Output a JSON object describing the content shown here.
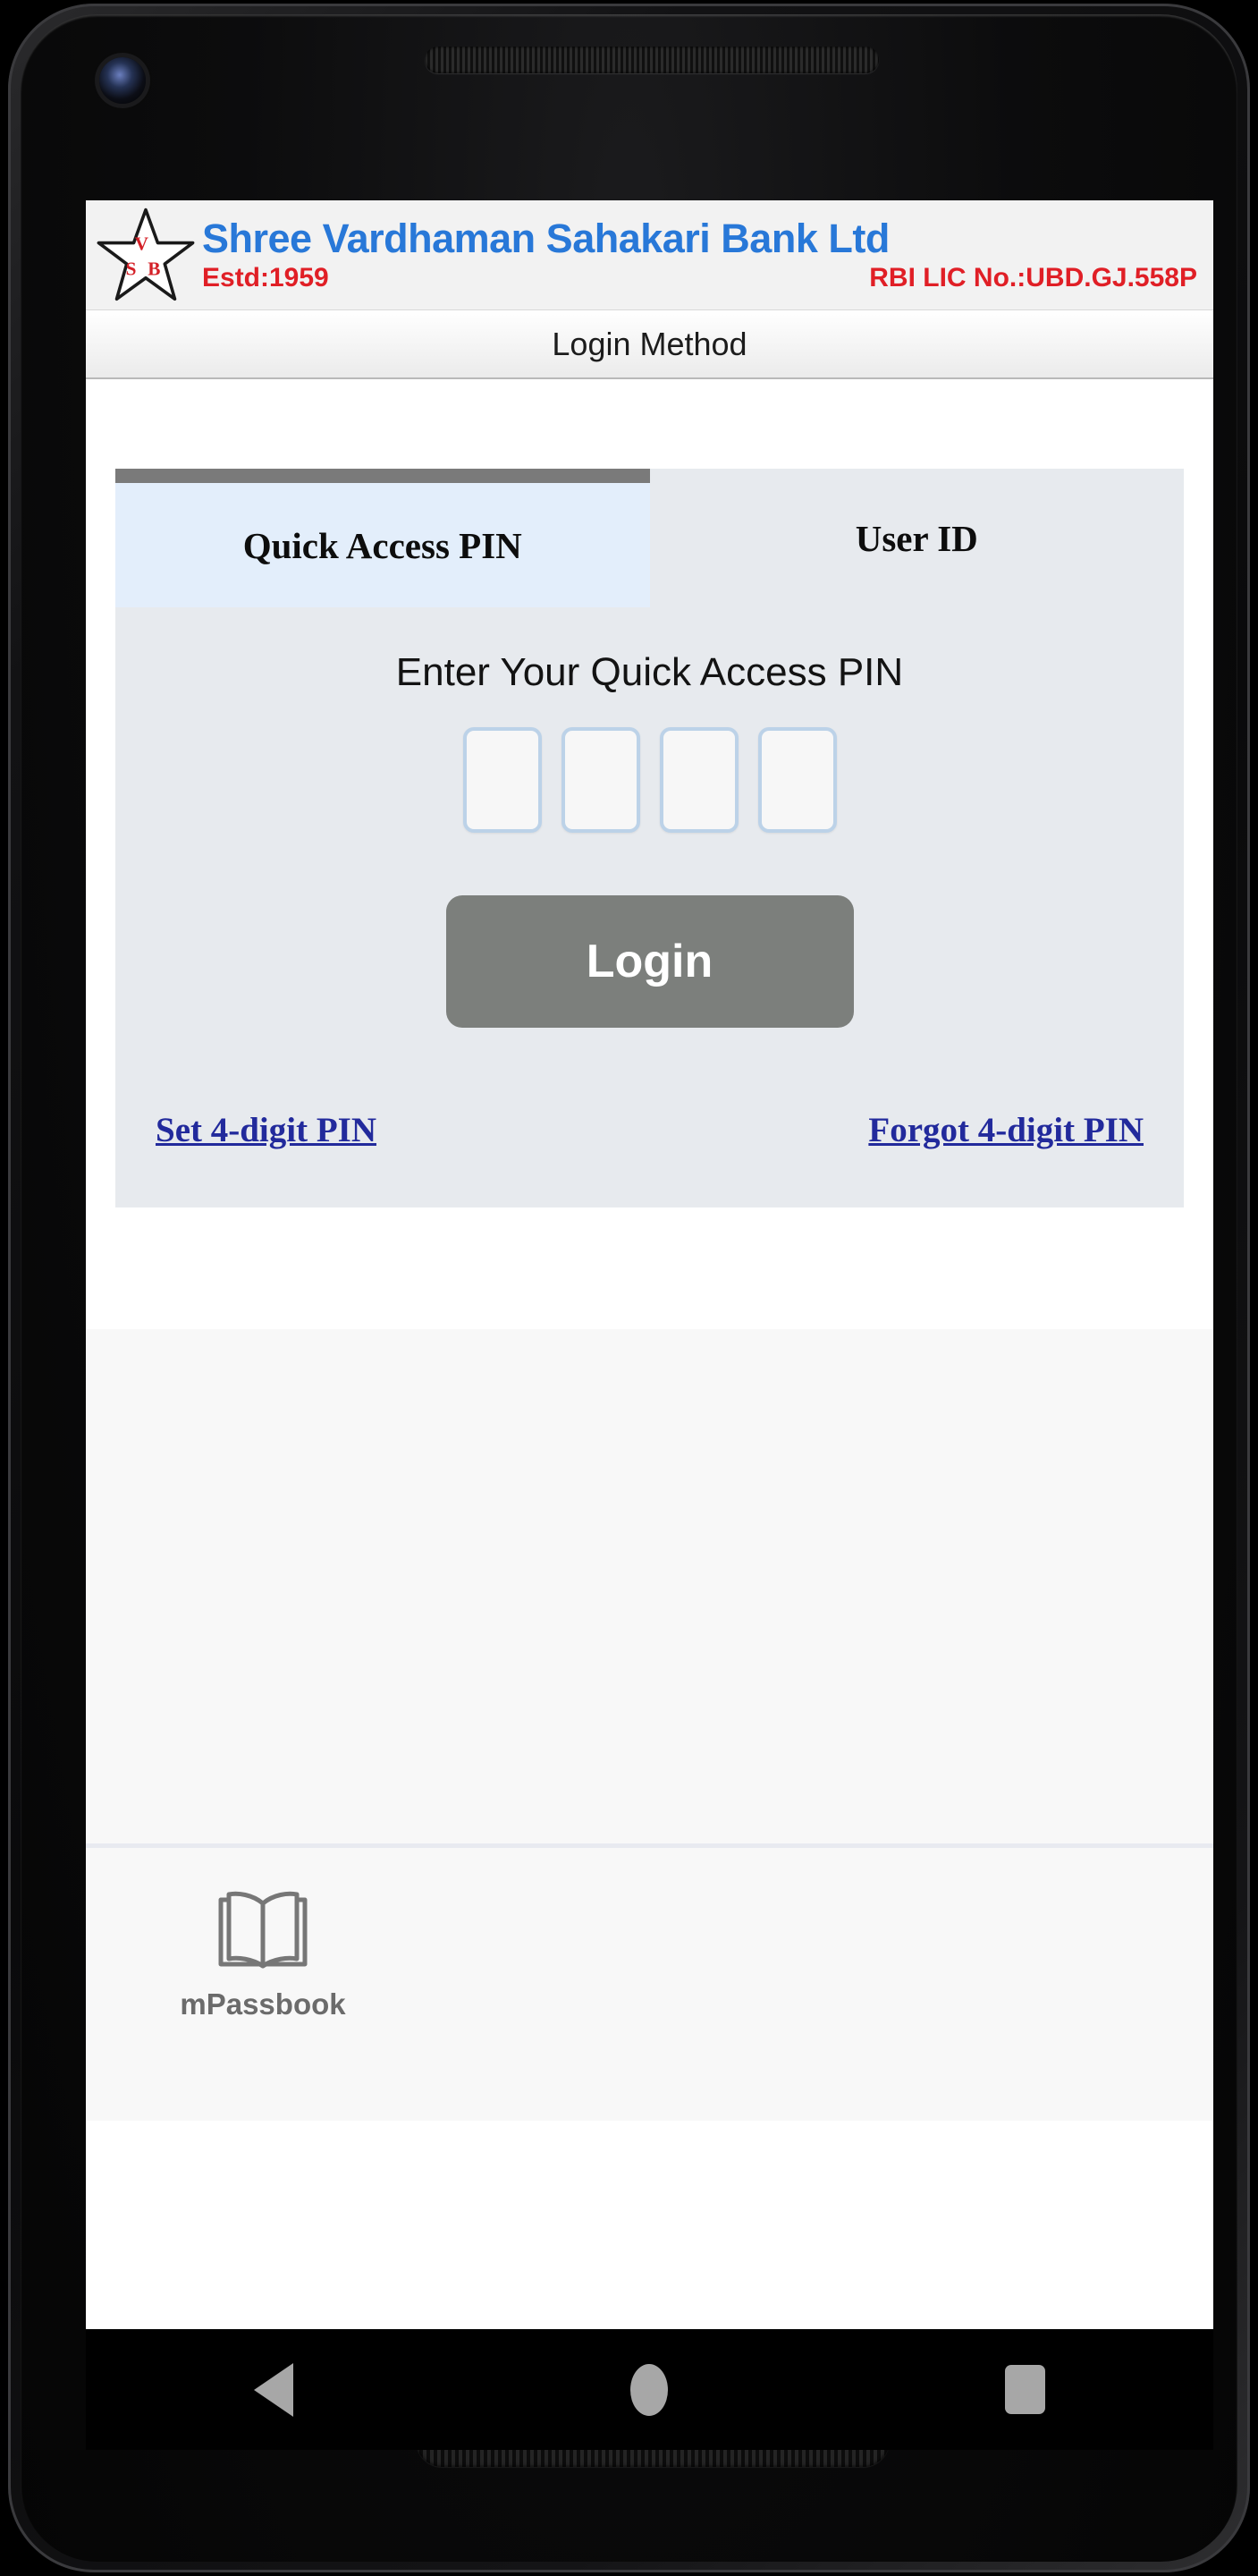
{
  "bank_header": {
    "logo_icon": "vsb-star-logo",
    "logo_letters": {
      "top": "V",
      "left": "S",
      "right": "B"
    },
    "bank_name": "Shree Vardhaman Sahakari Bank Ltd",
    "established": "Estd:1959",
    "rbi_license": "RBI LIC No.:UBD.GJ.558P",
    "colors": {
      "name_blue": "#2878d8",
      "accent_red": "#e01f26",
      "background": "#f2f2f2"
    }
  },
  "title_bar": {
    "title": "Login Method"
  },
  "login_card": {
    "tabs": [
      {
        "label": "Quick Access PIN",
        "active": true
      },
      {
        "label": "User ID",
        "active": false
      }
    ],
    "heading": "Enter Your Quick Access PIN",
    "pin_inputs": [
      {
        "value": "",
        "placeholder": ""
      },
      {
        "value": "",
        "placeholder": ""
      },
      {
        "value": "",
        "placeholder": ""
      },
      {
        "value": "",
        "placeholder": ""
      }
    ],
    "pin_length": 4,
    "login_button": "Login",
    "links": [
      {
        "label": "Set 4-digit PIN"
      },
      {
        "label": "Forgot 4-digit PIN"
      }
    ],
    "colors": {
      "card_background": "#e7eaee",
      "active_tab_background": "#e3eefb",
      "active_tab_indicator": "#7a7a7a",
      "button_background": "#7c7f7c",
      "link_color": "#222a9c",
      "pin_border": "#bcd2e8"
    }
  },
  "bottom_nav": {
    "items": [
      {
        "label": "mPassbook",
        "icon": "open-book-icon"
      }
    ]
  },
  "android_nav": {
    "back": "back-button",
    "home": "home-button",
    "recents": "recents-button"
  },
  "device": {
    "earpiece": "earpiece-grille",
    "camera": "front-camera",
    "speaker": "bottom-speaker"
  }
}
